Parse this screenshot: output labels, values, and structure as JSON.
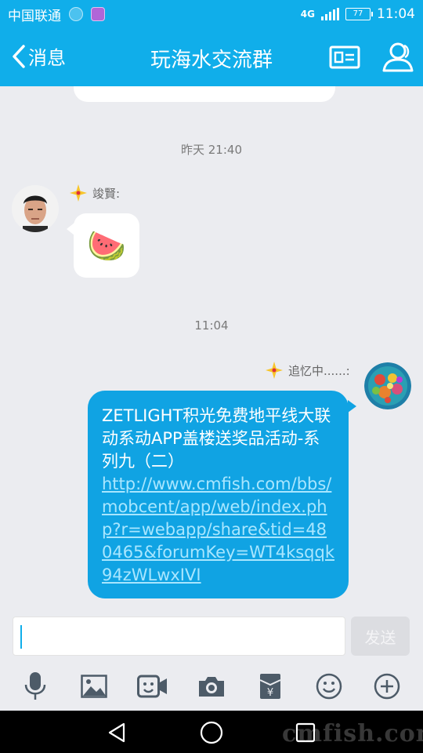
{
  "status_bar": {
    "carrier": "中国联通",
    "network": "4G",
    "battery": "77",
    "time": "11:04"
  },
  "header": {
    "back_label": "消息",
    "title": "玩海水交流群"
  },
  "chat": {
    "messages": [
      {
        "timestamp": "昨天 21:40",
        "sender": "竣賢:",
        "content": "🍉"
      },
      {
        "timestamp": "11:04",
        "sender": "追忆中......:",
        "text": "ZETLIGHT积光免费地平线大联动系动APP盖楼送奖品活动-系列九（二）",
        "link": "http://www.cmfish.com/bbs/mobcent/app/web/index.php?r=webapp/share&tid=480465&forumKey=WT4ksqqk94zWLwxIVI"
      }
    ]
  },
  "input": {
    "placeholder": "",
    "send_label": "发送"
  },
  "toolbar": {
    "icons": [
      "microphone-icon",
      "image-icon",
      "video-icon",
      "camera-icon",
      "red-packet-icon",
      "emoji-icon",
      "plus-icon"
    ]
  },
  "watermark": "cmfish.com",
  "colors": {
    "accent": "#10aeea",
    "bubble_self": "#10a3e3",
    "background": "#ebecf0"
  }
}
